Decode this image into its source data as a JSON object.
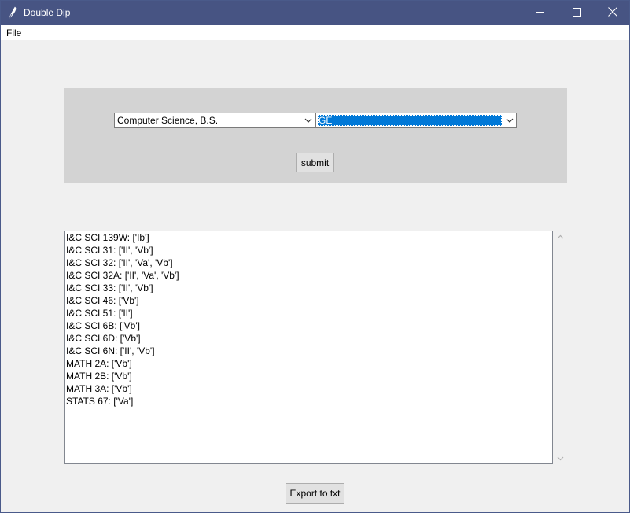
{
  "window": {
    "title": "Double Dip",
    "icon": "feather-icon",
    "controls": [
      "minimize-icon",
      "maximize-icon",
      "close-icon"
    ]
  },
  "menu": {
    "file_label": "File"
  },
  "selectors": {
    "major": {
      "value": "Computer Science, B.S."
    },
    "category": {
      "value": "GE"
    }
  },
  "buttons": {
    "submit_label": "submit",
    "export_label": "Export to txt"
  },
  "results": [
    "I&C SCI 139W: ['Ib']",
    "I&C SCI 31: ['II', 'Vb']",
    "I&C SCI 32: ['II', 'Va', 'Vb']",
    "I&C SCI 32A: ['II', 'Va', 'Vb']",
    "I&C SCI 33: ['II', 'Vb']",
    "I&C SCI 46: ['Vb']",
    "I&C SCI 51: ['II']",
    "I&C SCI 6B: ['Vb']",
    "I&C SCI 6D: ['Vb']",
    "I&C SCI 6N: ['II', 'Vb']",
    "MATH 2A: ['Vb']",
    "MATH 2B: ['Vb']",
    "MATH 3A: ['Vb']",
    "STATS 67: ['Va']"
  ],
  "colors": {
    "titlebar": "#475483",
    "panel": "#d3d3d3",
    "selection": "#0078d7",
    "window_bg": "#f0f0f0"
  }
}
